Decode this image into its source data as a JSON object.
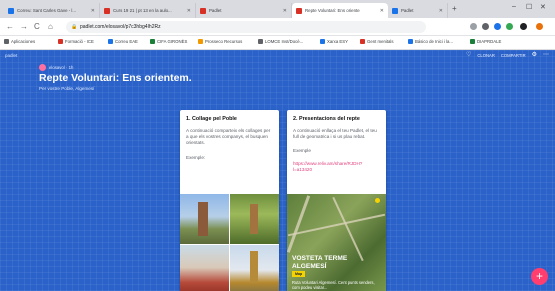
{
  "browser": {
    "tabs": [
      {
        "title": "Correu: Sant Carles Gave - l...",
        "color": "#1a73e8"
      },
      {
        "title": "Curs 19 21 | pt 13 en la aulo...",
        "color": "#d93025"
      },
      {
        "title": "Padlet",
        "color": "#d93025"
      },
      {
        "title": "Repte Voluntari: Ens oriente",
        "color": "#d93025",
        "active": true
      },
      {
        "title": "Padlet",
        "color": "#1a73e8"
      }
    ],
    "new_tab": "+",
    "window_controls": {
      "minimize": "–",
      "maximize": "☐",
      "close": "✕"
    },
    "nav": {
      "back": "←",
      "forward": "→",
      "reload": "C",
      "home": "⌂"
    },
    "url": "padlet.com/elosavol/p7c3hbg4Ih2Rz",
    "bookmarks": [
      {
        "label": "Aplicaciones",
        "color": "#5f6368"
      },
      {
        "label": "Formació - ICE",
        "color": "#d93025"
      },
      {
        "label": "Correu EAE",
        "color": "#1a73e8"
      },
      {
        "label": "CIFA GIRONÈS",
        "color": "#188038"
      },
      {
        "label": "Prosseco Recursos",
        "color": "#f29900"
      },
      {
        "label": "LOMCE Inst/Docè...",
        "color": "#5f6368"
      },
      {
        "label": "Xarxa ESY",
        "color": "#1a73e8"
      },
      {
        "label": "Gent menitals",
        "color": "#d93025"
      },
      {
        "label": "Básico de Inici i la...",
        "color": "#1a73e8"
      },
      {
        "label": "DIAPRDALE",
        "color": "#188038"
      }
    ]
  },
  "padlet": {
    "logo_text": "padlet",
    "toolbar": {
      "like": "♡",
      "clone": "CLONAR",
      "share": "COMPARTIR",
      "settings": "⚙",
      "more": "⋯"
    },
    "author": "elosavol · 1h",
    "title": "Repte Voluntari: Ens orientem.",
    "subtitle": "Per vostre Poble, Algemesí",
    "cards": [
      {
        "title": "1. Collage pel Poble",
        "body": "A continuació comparteix els collages per a que els vostres companys, el busquen orientats.",
        "label": "Exemple:"
      },
      {
        "title": "2. Presentacions del repte",
        "body": "A continuació enllaça el teu Padlet, el teu full de geomatrica i si us plau rebat.",
        "label": "Exemple",
        "link": "https://www.reliv.am/share/RJDH?l=a13420",
        "map_title": "VOSTETA TERME ALGEMESÍ",
        "map_tag": "Map",
        "map_desc": "Ruta Voluntari Algemesí. Cent punts senders, com podeu visitar..."
      }
    ],
    "fab": "+"
  }
}
